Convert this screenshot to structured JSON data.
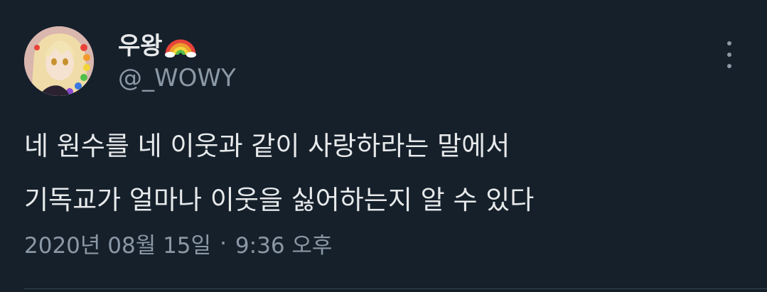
{
  "tweet": {
    "display_name": "우왕",
    "name_emoji": "rainbow-emoji",
    "handle": "@_WOWY",
    "text_lines": [
      "네 원수를 네 이웃과 같이 사랑하라는 말에서",
      "기독교가 얼마나 이웃을 싫어하는지 알 수 있다"
    ],
    "date": "2020년 08월 15일",
    "separator": "·",
    "time": "9:36 오후"
  },
  "icons": {
    "more": "more-options-icon",
    "avatar": "profile-avatar"
  },
  "colors": {
    "background": "#15202b",
    "primary_text": "#e7e9ea",
    "secondary_text": "#8b98a5",
    "divider": "#38444d"
  }
}
